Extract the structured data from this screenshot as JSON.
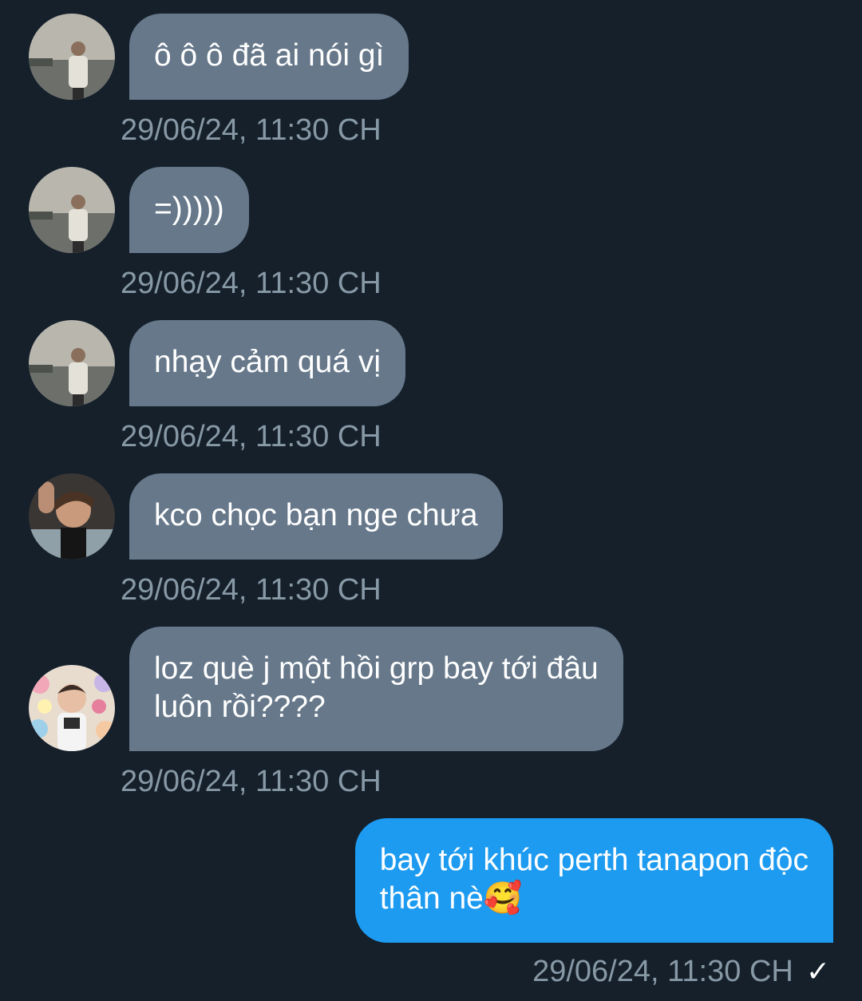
{
  "messages": [
    {
      "text": "ô ô ô đã ai nói gì",
      "timestamp": "29/06/24, 11:30 CH",
      "avatar": "avatar-user-1"
    },
    {
      "text": "=)))))",
      "timestamp": "29/06/24, 11:30 CH",
      "avatar": "avatar-user-1"
    },
    {
      "text": "nhạy cảm quá vị",
      "timestamp": "29/06/24, 11:30 CH",
      "avatar": "avatar-user-1"
    },
    {
      "text": "kco chọc bạn nge chưa",
      "timestamp": "29/06/24, 11:30 CH",
      "avatar": "avatar-user-2"
    },
    {
      "line1": "loz què j một hồi grp bay tới đâu",
      "line2": "luôn rồi????",
      "timestamp": "29/06/24, 11:30 CH",
      "avatar": "avatar-user-3"
    }
  ],
  "outgoing": {
    "line1": "bay tới khúc perth tanapon độc",
    "line2": "thân nè",
    "emoji": "🥰",
    "timestamp": "29/06/24, 11:30 CH",
    "status_icon": "check-icon",
    "status_glyph": "✓"
  },
  "colors": {
    "background": "#15202b",
    "incoming_bubble": "#66788a",
    "outgoing_bubble": "#1d9bf0",
    "timestamp": "#8899a6"
  }
}
